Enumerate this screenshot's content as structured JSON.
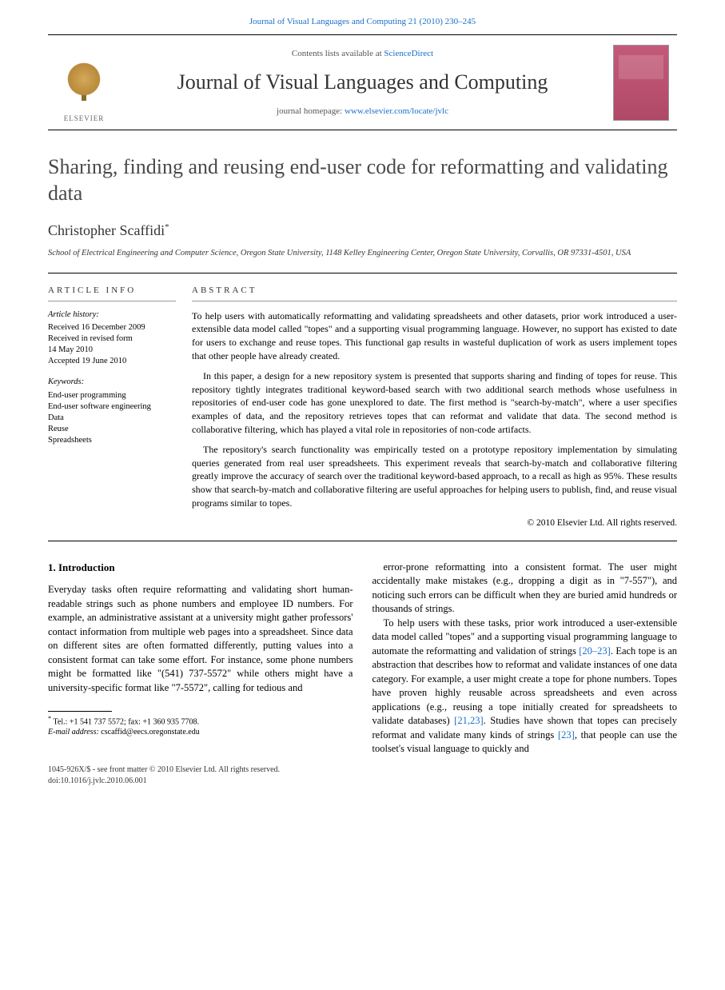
{
  "header": {
    "citation_prefix": "Journal of Visual Languages and Computing 21 (2010) 230–245"
  },
  "masthead": {
    "publisher": "ELSEVIER",
    "contents_prefix": "Contents lists available at ",
    "contents_link": "ScienceDirect",
    "journal_name": "Journal of Visual Languages and Computing",
    "homepage_prefix": "journal homepage: ",
    "homepage_url": "www.elsevier.com/locate/jvlc"
  },
  "article": {
    "title": "Sharing, finding and reusing end-user code for reformatting and validating data",
    "author": "Christopher Scaffidi",
    "author_marker": "*",
    "affiliation": "School of Electrical Engineering and Computer Science, Oregon State University, 1148 Kelley Engineering Center, Oregon State University, Corvallis, OR 97331-4501, USA"
  },
  "info": {
    "heading": "ARTICLE INFO",
    "history_label": "Article history:",
    "history_lines": [
      "Received 16 December 2009",
      "Received in revised form",
      "14 May 2010",
      "Accepted 19 June 2010"
    ],
    "keywords_label": "Keywords:",
    "keywords": [
      "End-user programming",
      "End-user software engineering",
      "Data",
      "Reuse",
      "Spreadsheets"
    ]
  },
  "abstract": {
    "heading": "ABSTRACT",
    "paragraphs": [
      "To help users with automatically reformatting and validating spreadsheets and other datasets, prior work introduced a user-extensible data model called \"topes\" and a supporting visual programming language. However, no support has existed to date for users to exchange and reuse topes. This functional gap results in wasteful duplication of work as users implement topes that other people have already created.",
      "In this paper, a design for a new repository system is presented that supports sharing and finding of topes for reuse. This repository tightly integrates traditional keyword-based search with two additional search methods whose usefulness in repositories of end-user code has gone unexplored to date. The first method is \"search-by-match\", where a user specifies examples of data, and the repository retrieves topes that can reformat and validate that data. The second method is collaborative filtering, which has played a vital role in repositories of non-code artifacts.",
      "The repository's search functionality was empirically tested on a prototype repository implementation by simulating queries generated from real user spreadsheets. This experiment reveals that search-by-match and collaborative filtering greatly improve the accuracy of search over the traditional keyword-based approach, to a recall as high as 95%. These results show that search-by-match and collaborative filtering are useful approaches for helping users to publish, find, and reuse visual programs similar to topes."
    ],
    "copyright": "© 2010 Elsevier Ltd. All rights reserved."
  },
  "body": {
    "section1_head": "1. Introduction",
    "p1": "Everyday tasks often require reformatting and validating short human-readable strings such as phone numbers and employee ID numbers. For example, an administrative assistant at a university might gather professors' contact information from multiple web pages into a spreadsheet. Since data on different sites are often formatted differently, putting values into a consistent format can take some effort. For instance, some phone numbers might be formatted like \"(541) 737-5572\" while others might have a university-specific format like \"7-5572\", calling for tedious and",
    "p2": "error-prone reformatting into a consistent format. The user might accidentally make mistakes (e.g., dropping a digit as in \"7-557\"), and noticing such errors can be difficult when they are buried amid hundreds or thousands of strings.",
    "p3_a": "To help users with these tasks, prior work introduced a user-extensible data model called \"topes\" and a supporting visual programming language to automate the reformatting and validation of strings ",
    "p3_ref1": "[20–23]",
    "p3_b": ". Each tope is an abstraction that describes how to reformat and validate instances of one data category. For example, a user might create a tope for phone numbers. Topes have proven highly reusable across spreadsheets and even across applications (e.g., reusing a tope initially created for spreadsheets to validate databases) ",
    "p3_ref2": "[21,23]",
    "p3_c": ". Studies have shown that topes can precisely reformat and validate many kinds of strings ",
    "p3_ref3": "[23]",
    "p3_d": ", that people can use the toolset's visual language to quickly and"
  },
  "footnote": {
    "star": "*",
    "tel": "Tel.: +1 541 737 5572; fax: +1 360 935 7708.",
    "email_label": "E-mail address:",
    "email": "cscaffid@eecs.oregonstate.edu"
  },
  "footer": {
    "line1": "1045-926X/$ - see front matter © 2010 Elsevier Ltd. All rights reserved.",
    "line2": "doi:10.1016/j.jvlc.2010.06.001"
  }
}
